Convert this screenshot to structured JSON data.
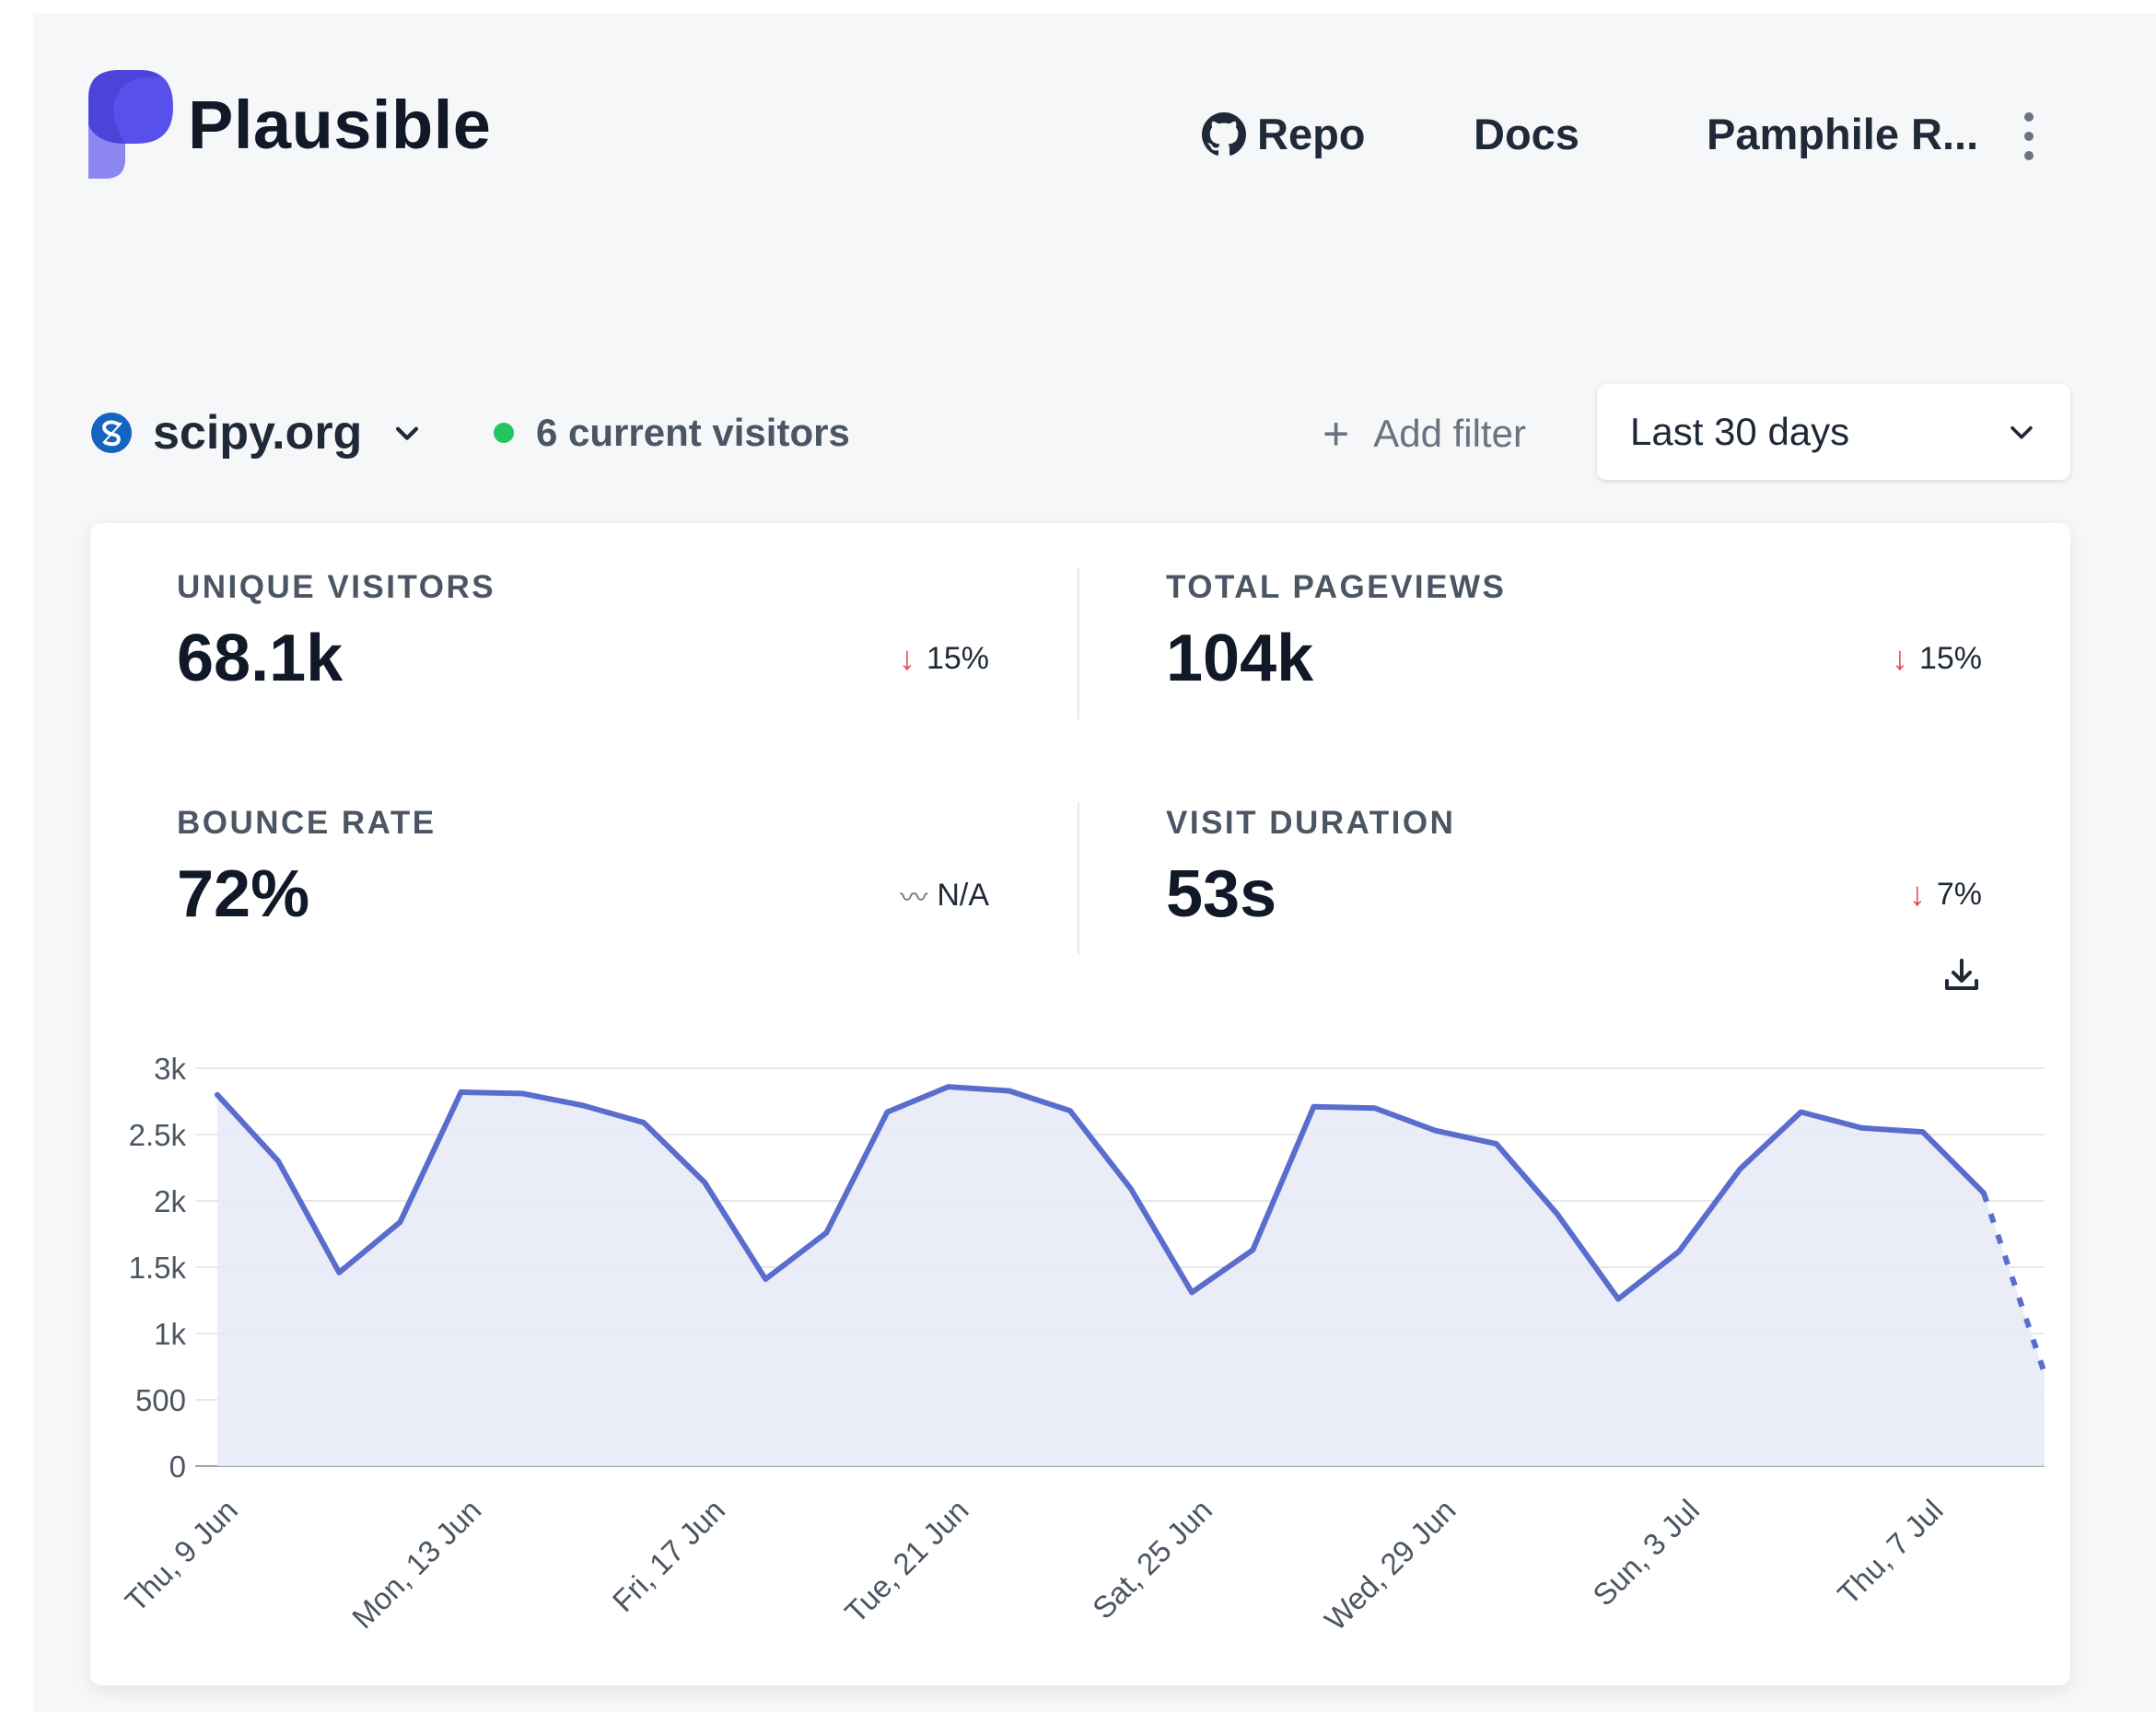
{
  "header": {
    "brand": "Plausible",
    "nav": {
      "repo_label": "Repo",
      "docs_label": "Docs",
      "user_label": "Pamphile R..."
    }
  },
  "site_bar": {
    "site_name": "scipy.org",
    "current_visitors": "6 current visitors",
    "add_filter_label": "Add filter",
    "period_label": "Last 30 days"
  },
  "metrics": [
    {
      "label": "UNIQUE VISITORS",
      "value": "68.1k",
      "change": "15%",
      "trend": "down"
    },
    {
      "label": "TOTAL PAGEVIEWS",
      "value": "104k",
      "change": "15%",
      "trend": "down"
    },
    {
      "label": "BOUNCE RATE",
      "value": "72%",
      "change": "N/A",
      "trend": "flat"
    },
    {
      "label": "VISIT DURATION",
      "value": "53s",
      "change": "7%",
      "trend": "down"
    }
  ],
  "colors": {
    "accent": "#5a6dcd",
    "area_fill": "#e8eaf7",
    "down_arrow": "#ef4444",
    "live_dot": "#22c55e"
  },
  "icons": {
    "logo": "plausible-logo-icon",
    "github": "github-icon",
    "more": "kebab-icon",
    "site_favicon": "scipy-favicon-icon",
    "chevron": "chevron-down-icon",
    "add": "plus-icon",
    "download": "download-icon"
  },
  "chart_data": {
    "type": "area",
    "ylim": [
      0,
      3000
    ],
    "y_ticks": [
      0,
      500,
      1000,
      1500,
      2000,
      2500,
      3000
    ],
    "y_tick_labels": [
      "0",
      "500",
      "1k",
      "1.5k",
      "2k",
      "2.5k",
      "3k"
    ],
    "x_tick_labels": [
      "Thu, 9 Jun",
      "Mon, 13 Jun",
      "Fri, 17 Jun",
      "Tue, 21 Jun",
      "Sat, 25 Jun",
      "Wed, 29 Jun",
      "Sun, 3 Jul",
      "Thu, 7 Jul"
    ],
    "x_tick_every": 4,
    "dates": [
      "9 Jun",
      "10 Jun",
      "11 Jun",
      "12 Jun",
      "13 Jun",
      "14 Jun",
      "15 Jun",
      "16 Jun",
      "17 Jun",
      "18 Jun",
      "19 Jun",
      "20 Jun",
      "21 Jun",
      "22 Jun",
      "23 Jun",
      "24 Jun",
      "25 Jun",
      "26 Jun",
      "27 Jun",
      "28 Jun",
      "29 Jun",
      "30 Jun",
      "1 Jul",
      "2 Jul",
      "3 Jul",
      "4 Jul",
      "5 Jul",
      "6 Jul",
      "7 Jul",
      "8 Jul",
      "9 Jul"
    ],
    "series": [
      {
        "values": [
          2800,
          2300,
          1460,
          1840,
          2820,
          2810,
          2720,
          2590,
          2140,
          1410,
          1760,
          2670,
          2860,
          2830,
          2680,
          2090,
          1310,
          1630,
          2710,
          2700,
          2530,
          2430,
          1900,
          1260,
          1620,
          2240,
          2670,
          2550,
          2520,
          2060,
          700
        ],
        "partial_last_point": true
      }
    ],
    "grid": true,
    "legend": "none"
  }
}
